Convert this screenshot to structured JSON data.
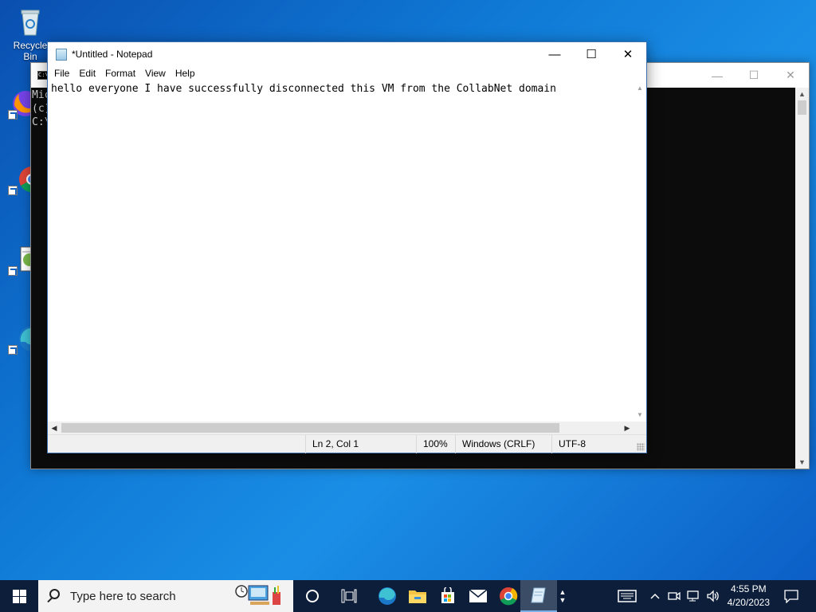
{
  "desktop": {
    "icons": [
      {
        "label": "Recycle Bin",
        "icon": "recycle-bin-icon"
      },
      {
        "label": "Firefox",
        "icon": "firefox-icon"
      },
      {
        "label": "Google Chrome",
        "icon": "chrome-icon"
      },
      {
        "label": "Notepad",
        "icon": "notepad-icon"
      },
      {
        "label": "Microsoft Edge",
        "icon": "edge-icon"
      }
    ]
  },
  "cmd_window": {
    "lines": [
      "Mic",
      "(c)",
      "C:\\"
    ],
    "controls": {
      "minimize": "—",
      "maximize": "☐",
      "close": "✕"
    }
  },
  "notepad": {
    "title": "*Untitled - Notepad",
    "controls": {
      "minimize": "—",
      "maximize": "☐",
      "close": "✕"
    },
    "menu": [
      "File",
      "Edit",
      "Format",
      "View",
      "Help"
    ],
    "content": "hello everyone I have successfully disconnected this VM from the CollabNet domain",
    "status": {
      "position": "Ln 2, Col 1",
      "zoom": "100%",
      "line_ending": "Windows (CRLF)",
      "encoding": "UTF-8"
    }
  },
  "taskbar": {
    "search_placeholder": "Type here to search",
    "pinned": [
      "cortana-icon",
      "task-view-icon",
      "edge-icon",
      "file-explorer-icon",
      "store-icon",
      "mail-icon",
      "chrome-icon",
      "notepad-icon"
    ],
    "clock": {
      "time": "4:55 PM",
      "date": "4/20/2023"
    }
  }
}
